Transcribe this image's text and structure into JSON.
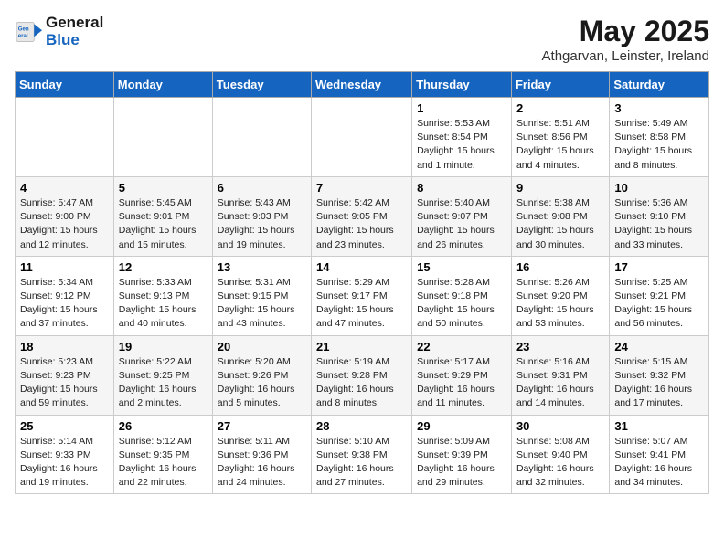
{
  "header": {
    "logo_line1": "General",
    "logo_line2": "Blue",
    "month": "May 2025",
    "location": "Athgarvan, Leinster, Ireland"
  },
  "weekdays": [
    "Sunday",
    "Monday",
    "Tuesday",
    "Wednesday",
    "Thursday",
    "Friday",
    "Saturday"
  ],
  "weeks": [
    [
      {
        "day": "",
        "info": ""
      },
      {
        "day": "",
        "info": ""
      },
      {
        "day": "",
        "info": ""
      },
      {
        "day": "",
        "info": ""
      },
      {
        "day": "1",
        "info": "Sunrise: 5:53 AM\nSunset: 8:54 PM\nDaylight: 15 hours\nand 1 minute."
      },
      {
        "day": "2",
        "info": "Sunrise: 5:51 AM\nSunset: 8:56 PM\nDaylight: 15 hours\nand 4 minutes."
      },
      {
        "day": "3",
        "info": "Sunrise: 5:49 AM\nSunset: 8:58 PM\nDaylight: 15 hours\nand 8 minutes."
      }
    ],
    [
      {
        "day": "4",
        "info": "Sunrise: 5:47 AM\nSunset: 9:00 PM\nDaylight: 15 hours\nand 12 minutes."
      },
      {
        "day": "5",
        "info": "Sunrise: 5:45 AM\nSunset: 9:01 PM\nDaylight: 15 hours\nand 15 minutes."
      },
      {
        "day": "6",
        "info": "Sunrise: 5:43 AM\nSunset: 9:03 PM\nDaylight: 15 hours\nand 19 minutes."
      },
      {
        "day": "7",
        "info": "Sunrise: 5:42 AM\nSunset: 9:05 PM\nDaylight: 15 hours\nand 23 minutes."
      },
      {
        "day": "8",
        "info": "Sunrise: 5:40 AM\nSunset: 9:07 PM\nDaylight: 15 hours\nand 26 minutes."
      },
      {
        "day": "9",
        "info": "Sunrise: 5:38 AM\nSunset: 9:08 PM\nDaylight: 15 hours\nand 30 minutes."
      },
      {
        "day": "10",
        "info": "Sunrise: 5:36 AM\nSunset: 9:10 PM\nDaylight: 15 hours\nand 33 minutes."
      }
    ],
    [
      {
        "day": "11",
        "info": "Sunrise: 5:34 AM\nSunset: 9:12 PM\nDaylight: 15 hours\nand 37 minutes."
      },
      {
        "day": "12",
        "info": "Sunrise: 5:33 AM\nSunset: 9:13 PM\nDaylight: 15 hours\nand 40 minutes."
      },
      {
        "day": "13",
        "info": "Sunrise: 5:31 AM\nSunset: 9:15 PM\nDaylight: 15 hours\nand 43 minutes."
      },
      {
        "day": "14",
        "info": "Sunrise: 5:29 AM\nSunset: 9:17 PM\nDaylight: 15 hours\nand 47 minutes."
      },
      {
        "day": "15",
        "info": "Sunrise: 5:28 AM\nSunset: 9:18 PM\nDaylight: 15 hours\nand 50 minutes."
      },
      {
        "day": "16",
        "info": "Sunrise: 5:26 AM\nSunset: 9:20 PM\nDaylight: 15 hours\nand 53 minutes."
      },
      {
        "day": "17",
        "info": "Sunrise: 5:25 AM\nSunset: 9:21 PM\nDaylight: 15 hours\nand 56 minutes."
      }
    ],
    [
      {
        "day": "18",
        "info": "Sunrise: 5:23 AM\nSunset: 9:23 PM\nDaylight: 15 hours\nand 59 minutes."
      },
      {
        "day": "19",
        "info": "Sunrise: 5:22 AM\nSunset: 9:25 PM\nDaylight: 16 hours\nand 2 minutes."
      },
      {
        "day": "20",
        "info": "Sunrise: 5:20 AM\nSunset: 9:26 PM\nDaylight: 16 hours\nand 5 minutes."
      },
      {
        "day": "21",
        "info": "Sunrise: 5:19 AM\nSunset: 9:28 PM\nDaylight: 16 hours\nand 8 minutes."
      },
      {
        "day": "22",
        "info": "Sunrise: 5:17 AM\nSunset: 9:29 PM\nDaylight: 16 hours\nand 11 minutes."
      },
      {
        "day": "23",
        "info": "Sunrise: 5:16 AM\nSunset: 9:31 PM\nDaylight: 16 hours\nand 14 minutes."
      },
      {
        "day": "24",
        "info": "Sunrise: 5:15 AM\nSunset: 9:32 PM\nDaylight: 16 hours\nand 17 minutes."
      }
    ],
    [
      {
        "day": "25",
        "info": "Sunrise: 5:14 AM\nSunset: 9:33 PM\nDaylight: 16 hours\nand 19 minutes."
      },
      {
        "day": "26",
        "info": "Sunrise: 5:12 AM\nSunset: 9:35 PM\nDaylight: 16 hours\nand 22 minutes."
      },
      {
        "day": "27",
        "info": "Sunrise: 5:11 AM\nSunset: 9:36 PM\nDaylight: 16 hours\nand 24 minutes."
      },
      {
        "day": "28",
        "info": "Sunrise: 5:10 AM\nSunset: 9:38 PM\nDaylight: 16 hours\nand 27 minutes."
      },
      {
        "day": "29",
        "info": "Sunrise: 5:09 AM\nSunset: 9:39 PM\nDaylight: 16 hours\nand 29 minutes."
      },
      {
        "day": "30",
        "info": "Sunrise: 5:08 AM\nSunset: 9:40 PM\nDaylight: 16 hours\nand 32 minutes."
      },
      {
        "day": "31",
        "info": "Sunrise: 5:07 AM\nSunset: 9:41 PM\nDaylight: 16 hours\nand 34 minutes."
      }
    ]
  ]
}
